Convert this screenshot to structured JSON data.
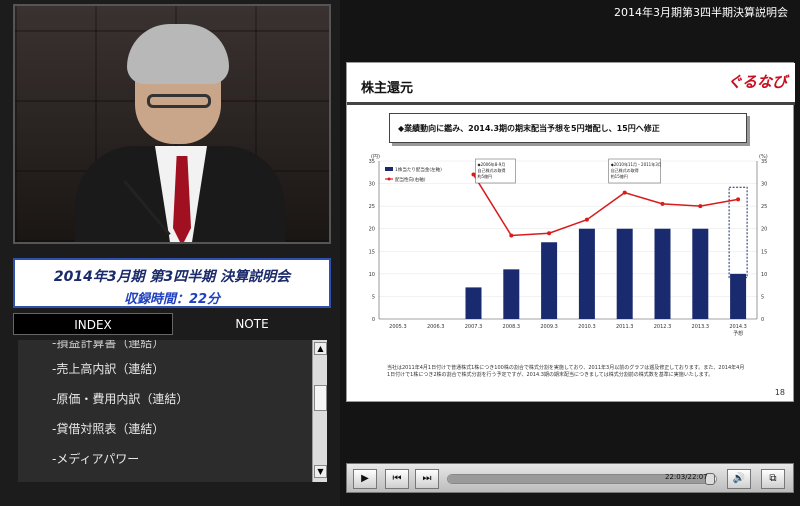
{
  "header": {
    "title": "2014年3月期第3四半期決算説明会"
  },
  "event": {
    "title": "2014年3月期 第3四半期 決算説明会",
    "duration_label": "収録時間：22分"
  },
  "tabs": [
    {
      "label": "INDEX",
      "active": true
    },
    {
      "label": "NOTE",
      "active": false
    }
  ],
  "index_items": [
    {
      "label": "-損益計算書（連結）",
      "partial": true
    },
    {
      "label": "-売上高内訳（連結）"
    },
    {
      "label": "-原価・費用内訳（連結）"
    },
    {
      "label": "-貸借対照表（連結）"
    },
    {
      "label": "-メディアパワー"
    }
  ],
  "slide": {
    "heading": "株主還元",
    "logo": "ぐるなび",
    "note": "◆業績動向に鑑み、2014.3期の期末配当予想を5円増配し、15円へ修正",
    "footnote": "当社は2011年4月1日付けで普通株式1株につき100株の割合で株式分割を実施しており、2011年3月以前のグラフは遡及修正しております。また、2014年4月1日付けで1株につき2株の割合で株式分割を行う予定ですが、2014.3期の期末配当につきましては株式分割前の株式数を基準に実施いたします。",
    "page": "18"
  },
  "chart_data": {
    "type": "bar",
    "categories": [
      "2005.3",
      "2006.3",
      "2007.3",
      "2008.3",
      "2009.3",
      "2010.3",
      "2011.3",
      "2012.3",
      "2013.3",
      "2014.3"
    ],
    "category_sublabels": [
      "",
      "",
      "",
      "",
      "",
      "",
      "",
      "",
      "",
      "予想"
    ],
    "series": [
      {
        "name": "1株当たり配当金(左軸)",
        "type": "bar",
        "values": [
          0,
          0,
          7,
          11,
          17,
          20,
          20,
          20,
          20,
          10
        ],
        "color": "#1a2a6e"
      },
      {
        "name": "配当性向(右軸)",
        "type": "line",
        "values": [
          null,
          null,
          32,
          18.5,
          19,
          22,
          28,
          25.5,
          25,
          26.5
        ],
        "color": "#d81c1c"
      }
    ],
    "forecast_increase": {
      "category": "2014.3",
      "value_from": 10,
      "value_to": 15
    },
    "y_left": {
      "unit": "(円)",
      "ticks": [
        0,
        5,
        10,
        15,
        20,
        25,
        30,
        35
      ],
      "range": [
        0,
        35
      ]
    },
    "y_right": {
      "unit": "(%)",
      "ticks": [
        0,
        5,
        10,
        15,
        20,
        25,
        30,
        35
      ],
      "range": [
        0,
        35
      ]
    },
    "annotations": [
      {
        "lines": [
          "◆2006年8-9月",
          "自己株式の取得",
          "約5億円"
        ],
        "anchor": "2007.3"
      },
      {
        "lines": [
          "◆2010年11月・2011年3月",
          "自己株式の取得",
          "約15億円"
        ],
        "anchor": "2011.3"
      }
    ]
  },
  "player": {
    "play_icon": "play-icon",
    "prev_icon": "skip-back-icon",
    "next_icon": "skip-forward-icon",
    "time_label": "22:03/22:07",
    "progress": 0.99,
    "volume_icon": "speaker-icon",
    "screen_icon": "window-icon"
  }
}
